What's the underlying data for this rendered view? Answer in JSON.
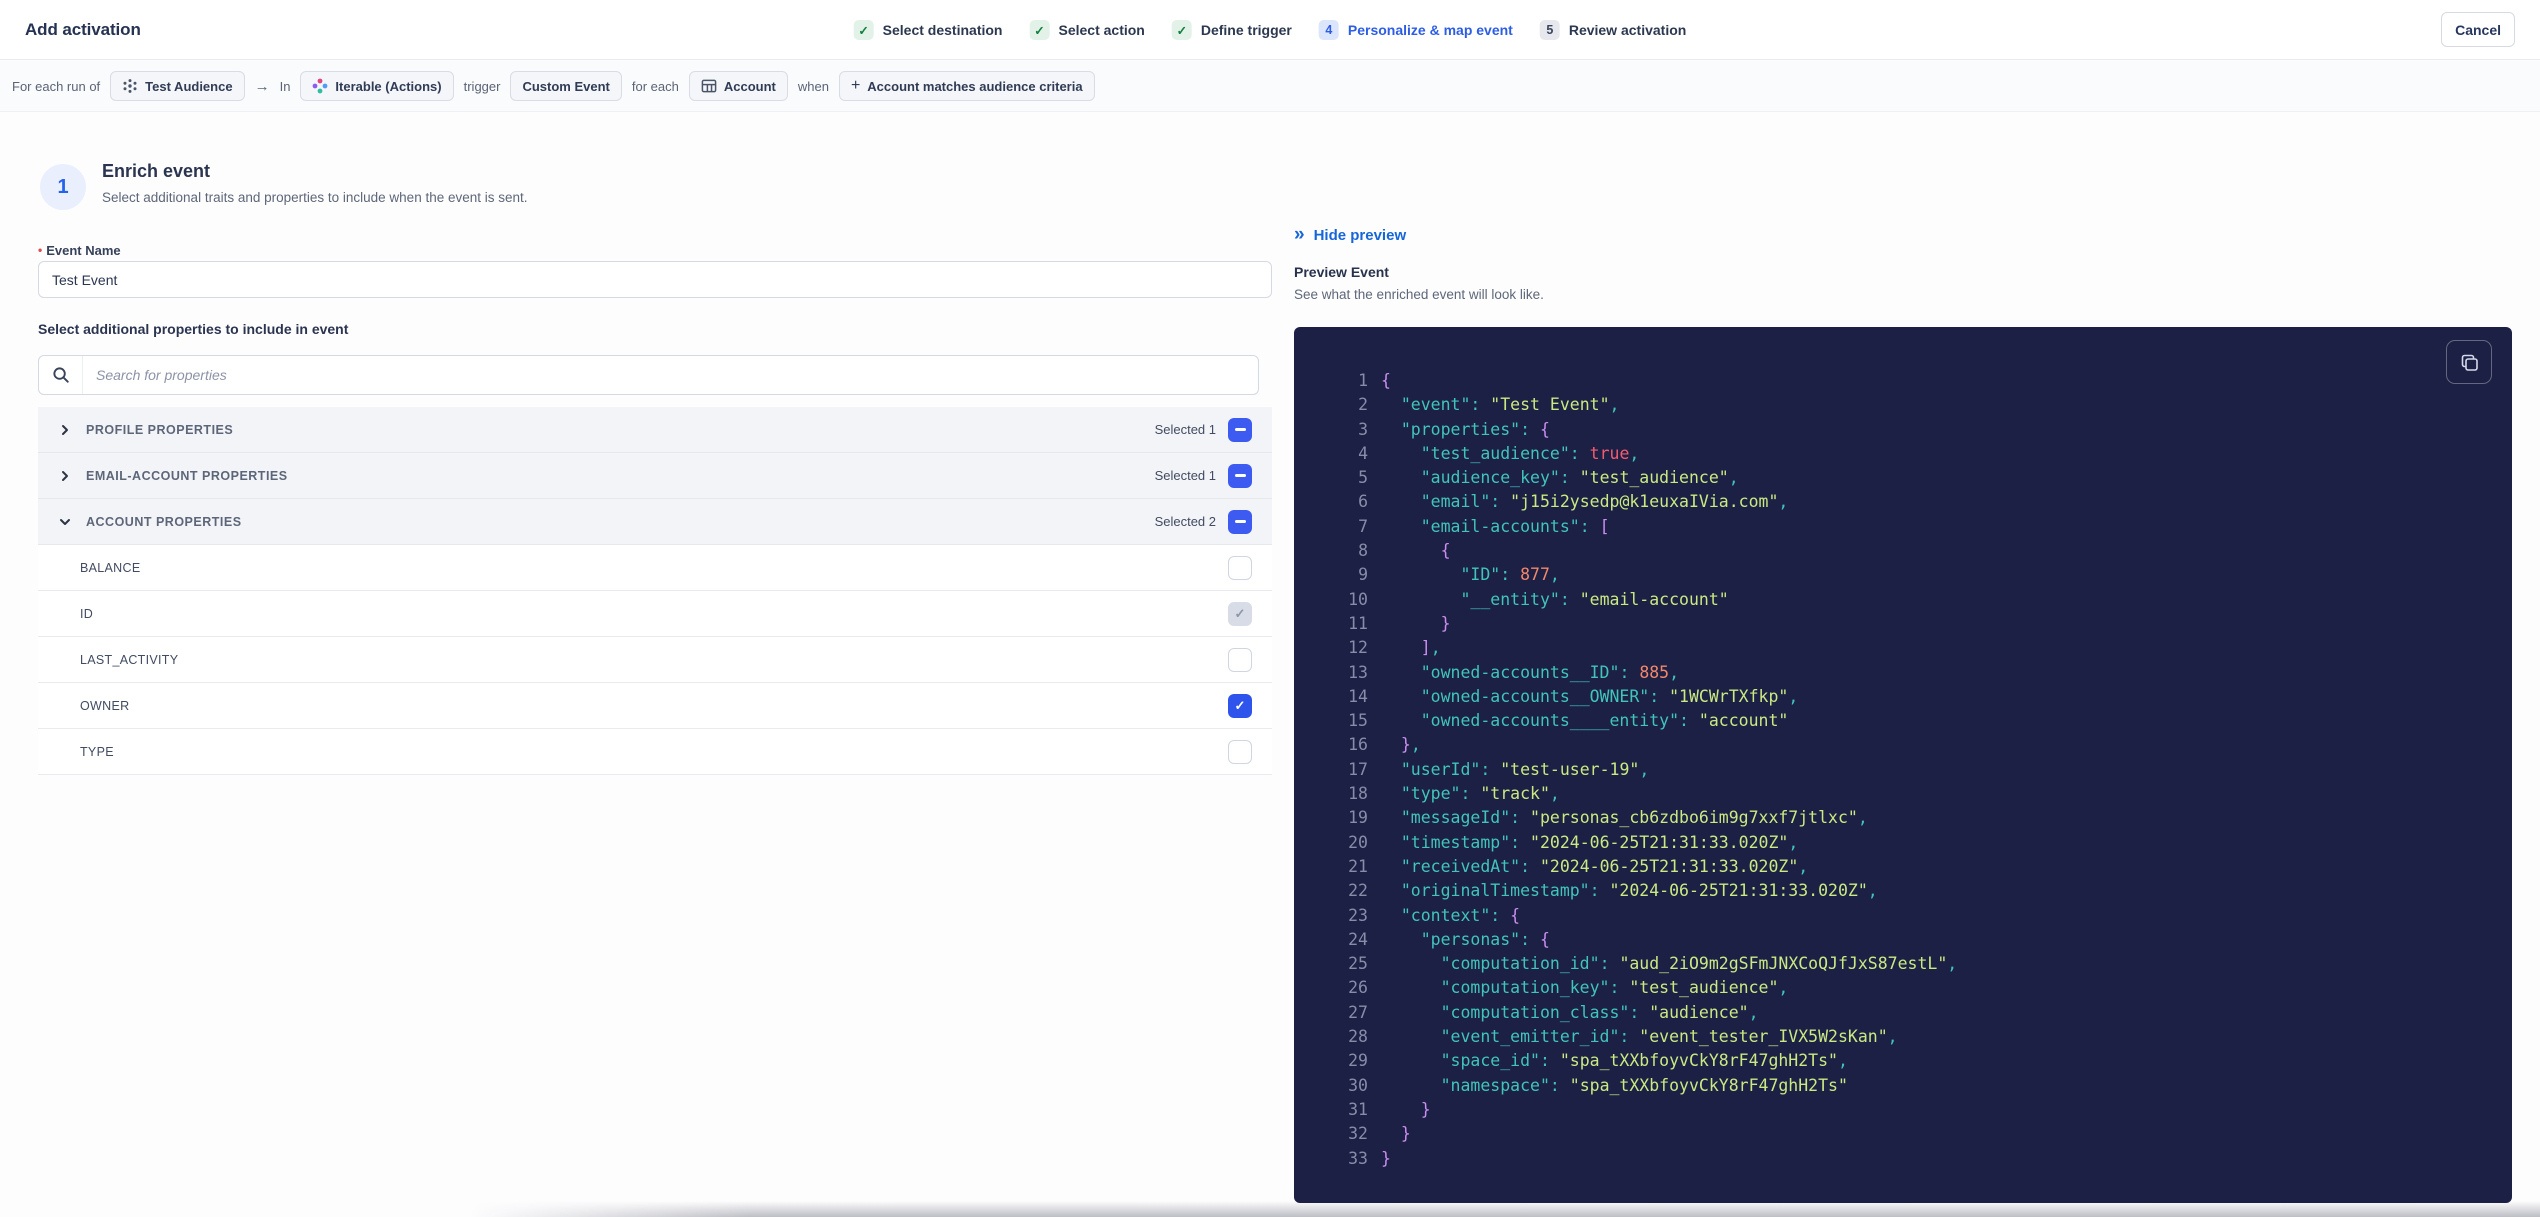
{
  "header": {
    "title": "Add activation",
    "cancel_label": "Cancel",
    "steps": [
      {
        "status": "done",
        "label": "Select destination"
      },
      {
        "status": "done",
        "label": "Select action"
      },
      {
        "status": "done",
        "label": "Define trigger"
      },
      {
        "status": "active",
        "number": "4",
        "label": "Personalize & map event"
      },
      {
        "status": "todo",
        "number": "5",
        "label": "Review activation"
      }
    ]
  },
  "trigger_summary": {
    "segments": [
      {
        "type": "text",
        "text": "For each run of"
      },
      {
        "type": "chip",
        "icon": "audience-icon",
        "text": "Test Audience"
      },
      {
        "type": "arrow",
        "text": "→"
      },
      {
        "type": "text",
        "text": "In"
      },
      {
        "type": "chip",
        "icon": "iterable-icon",
        "text": "Iterable (Actions)"
      },
      {
        "type": "text",
        "text": "trigger"
      },
      {
        "type": "chip",
        "icon": "",
        "text": "Custom Event"
      },
      {
        "type": "text",
        "text": "for each"
      },
      {
        "type": "chip",
        "icon": "table-icon",
        "text": "Account"
      },
      {
        "type": "text",
        "text": "when"
      },
      {
        "type": "chip",
        "icon": "plus-icon",
        "text": "Account matches audience criteria"
      }
    ]
  },
  "enrich": {
    "step_number": "1",
    "title": "Enrich event",
    "subtitle": "Select additional traits and properties to include when the event is sent."
  },
  "form": {
    "required_marker": "•",
    "event_name_label": "Event Name",
    "event_name_value": "Test Event",
    "properties_label": "Select additional properties to include in event",
    "search_placeholder": "Search for properties",
    "sections": [
      {
        "label": "PROFILE PROPERTIES",
        "expanded": false,
        "selected": "Selected 1"
      },
      {
        "label": "EMAIL-ACCOUNT PROPERTIES",
        "expanded": false,
        "selected": "Selected 1"
      },
      {
        "label": "ACCOUNT PROPERTIES",
        "expanded": true,
        "selected": "Selected 2",
        "rows": [
          {
            "label": "BALANCE",
            "state": "unchecked"
          },
          {
            "label": "ID",
            "state": "checked-disabled"
          },
          {
            "label": "LAST_ACTIVITY",
            "state": "unchecked"
          },
          {
            "label": "OWNER",
            "state": "checked"
          },
          {
            "label": "TYPE",
            "state": "unchecked"
          }
        ]
      }
    ]
  },
  "preview": {
    "hide_icon": "»",
    "hide_label": "Hide preview",
    "title": "Preview Event",
    "subtitle": "See what the enriched event will look like.",
    "code": {
      "lines": [
        [
          [
            "br",
            "{"
          ]
        ],
        [
          [
            "t",
            "  "
          ],
          [
            "k",
            "\"event\""
          ],
          [
            "o",
            ": "
          ],
          [
            "s",
            "\"Test Event\""
          ],
          [
            "o",
            ","
          ]
        ],
        [
          [
            "t",
            "  "
          ],
          [
            "k",
            "\"properties\""
          ],
          [
            "o",
            ": "
          ],
          [
            "br",
            "{"
          ]
        ],
        [
          [
            "t",
            "    "
          ],
          [
            "k",
            "\"test_audience\""
          ],
          [
            "o",
            ": "
          ],
          [
            "b",
            "true"
          ],
          [
            "o",
            ","
          ]
        ],
        [
          [
            "t",
            "    "
          ],
          [
            "k",
            "\"audience_key\""
          ],
          [
            "o",
            ": "
          ],
          [
            "s",
            "\"test_audience\""
          ],
          [
            "o",
            ","
          ]
        ],
        [
          [
            "t",
            "    "
          ],
          [
            "k",
            "\"email\""
          ],
          [
            "o",
            ": "
          ],
          [
            "s",
            "\"j15i2ysedp@k1euxaIVia.com\""
          ],
          [
            "o",
            ","
          ]
        ],
        [
          [
            "t",
            "    "
          ],
          [
            "k",
            "\"email-accounts\""
          ],
          [
            "o",
            ": "
          ],
          [
            "br",
            "["
          ]
        ],
        [
          [
            "t",
            "      "
          ],
          [
            "br",
            "{"
          ]
        ],
        [
          [
            "t",
            "        "
          ],
          [
            "k",
            "\"ID\""
          ],
          [
            "o",
            ": "
          ],
          [
            "n",
            "877"
          ],
          [
            "o",
            ","
          ]
        ],
        [
          [
            "t",
            "        "
          ],
          [
            "k",
            "\"__entity\""
          ],
          [
            "o",
            ": "
          ],
          [
            "s",
            "\"email-account\""
          ]
        ],
        [
          [
            "t",
            "      "
          ],
          [
            "br",
            "}"
          ]
        ],
        [
          [
            "t",
            "    "
          ],
          [
            "br",
            "]"
          ],
          [
            "o",
            ","
          ]
        ],
        [
          [
            "t",
            "    "
          ],
          [
            "k",
            "\"owned-accounts__ID\""
          ],
          [
            "o",
            ": "
          ],
          [
            "n",
            "885"
          ],
          [
            "o",
            ","
          ]
        ],
        [
          [
            "t",
            "    "
          ],
          [
            "k",
            "\"owned-accounts__OWNER\""
          ],
          [
            "o",
            ": "
          ],
          [
            "s",
            "\"1WCWrTXfkp\""
          ],
          [
            "o",
            ","
          ]
        ],
        [
          [
            "t",
            "    "
          ],
          [
            "k",
            "\"owned-accounts____entity\""
          ],
          [
            "o",
            ": "
          ],
          [
            "s",
            "\"account\""
          ]
        ],
        [
          [
            "t",
            "  "
          ],
          [
            "br",
            "}"
          ],
          [
            "o",
            ","
          ]
        ],
        [
          [
            "t",
            "  "
          ],
          [
            "k",
            "\"userId\""
          ],
          [
            "o",
            ": "
          ],
          [
            "s",
            "\"test-user-19\""
          ],
          [
            "o",
            ","
          ]
        ],
        [
          [
            "t",
            "  "
          ],
          [
            "k",
            "\"type\""
          ],
          [
            "o",
            ": "
          ],
          [
            "s",
            "\"track\""
          ],
          [
            "o",
            ","
          ]
        ],
        [
          [
            "t",
            "  "
          ],
          [
            "k",
            "\"messageId\""
          ],
          [
            "o",
            ": "
          ],
          [
            "s",
            "\"personas_cb6zdbo6im9g7xxf7jtlxc\""
          ],
          [
            "o",
            ","
          ]
        ],
        [
          [
            "t",
            "  "
          ],
          [
            "k",
            "\"timestamp\""
          ],
          [
            "o",
            ": "
          ],
          [
            "s",
            "\"2024-06-25T21:31:33.020Z\""
          ],
          [
            "o",
            ","
          ]
        ],
        [
          [
            "t",
            "  "
          ],
          [
            "k",
            "\"receivedAt\""
          ],
          [
            "o",
            ": "
          ],
          [
            "s",
            "\"2024-06-25T21:31:33.020Z\""
          ],
          [
            "o",
            ","
          ]
        ],
        [
          [
            "t",
            "  "
          ],
          [
            "k",
            "\"originalTimestamp\""
          ],
          [
            "o",
            ": "
          ],
          [
            "s",
            "\"2024-06-25T21:31:33.020Z\""
          ],
          [
            "o",
            ","
          ]
        ],
        [
          [
            "t",
            "  "
          ],
          [
            "k",
            "\"context\""
          ],
          [
            "o",
            ": "
          ],
          [
            "br",
            "{"
          ]
        ],
        [
          [
            "t",
            "    "
          ],
          [
            "k",
            "\"personas\""
          ],
          [
            "o",
            ": "
          ],
          [
            "br",
            "{"
          ]
        ],
        [
          [
            "t",
            "      "
          ],
          [
            "k",
            "\"computation_id\""
          ],
          [
            "o",
            ": "
          ],
          [
            "s",
            "\"aud_2iO9m2gSFmJNXCoQJfJxS87estL\""
          ],
          [
            "o",
            ","
          ]
        ],
        [
          [
            "t",
            "      "
          ],
          [
            "k",
            "\"computation_key\""
          ],
          [
            "o",
            ": "
          ],
          [
            "s",
            "\"test_audience\""
          ],
          [
            "o",
            ","
          ]
        ],
        [
          [
            "t",
            "      "
          ],
          [
            "k",
            "\"computation_class\""
          ],
          [
            "o",
            ": "
          ],
          [
            "s",
            "\"audience\""
          ],
          [
            "o",
            ","
          ]
        ],
        [
          [
            "t",
            "      "
          ],
          [
            "k",
            "\"event_emitter_id\""
          ],
          [
            "o",
            ": "
          ],
          [
            "s",
            "\"event_tester_IVX5W2sKan\""
          ],
          [
            "o",
            ","
          ]
        ],
        [
          [
            "t",
            "      "
          ],
          [
            "k",
            "\"space_id\""
          ],
          [
            "o",
            ": "
          ],
          [
            "s",
            "\"spa_tXXbfoyvCkY8rF47ghH2Ts\""
          ],
          [
            "o",
            ","
          ]
        ],
        [
          [
            "t",
            "      "
          ],
          [
            "k",
            "\"namespace\""
          ],
          [
            "o",
            ": "
          ],
          [
            "s",
            "\"spa_tXXbfoyvCkY8rF47ghH2Ts\""
          ]
        ],
        [
          [
            "t",
            "    "
          ],
          [
            "br",
            "}"
          ]
        ],
        [
          [
            "t",
            "  "
          ],
          [
            "br",
            "}"
          ]
        ],
        [
          [
            "br",
            "}"
          ]
        ]
      ]
    }
  },
  "colors": {
    "accent_blue": "#2d5de3",
    "link_blue": "#1766d8",
    "checkbox_blue": "#2f54eb",
    "success_green": "#15803d",
    "required_red": "#e5484d",
    "panel_bg": "#1c2044",
    "code_key": "#41c4ba",
    "code_string": "#c9e983",
    "code_number": "#f2876b",
    "code_boolean": "#f25c72",
    "code_brace": "#cb8df0"
  }
}
